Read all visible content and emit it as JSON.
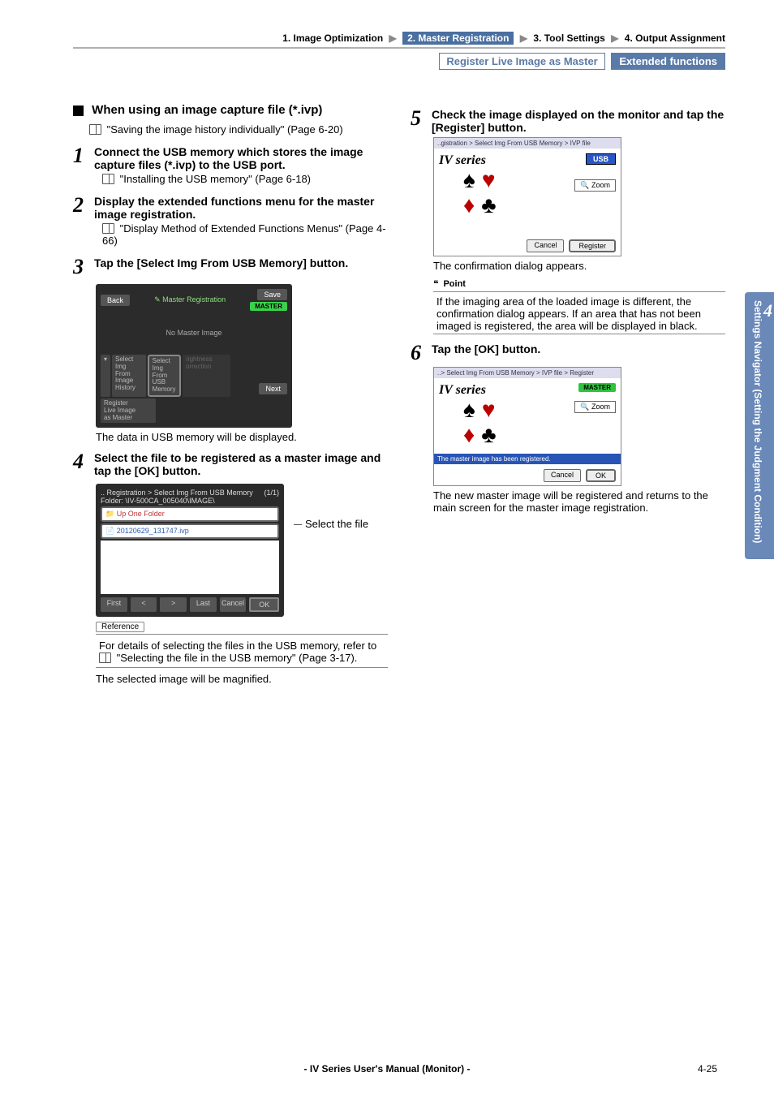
{
  "breadcrumb": {
    "item1": "1. Image Optimization",
    "item2": "2. Master Registration",
    "item3": "3. Tool Settings",
    "item4": "4. Output Assignment"
  },
  "subhead": {
    "left": "Register Live Image as Master",
    "right": "Extended functions"
  },
  "sidebar": {
    "num": "4",
    "label": "Settings Navigator (Setting the Judgment Condition)"
  },
  "left": {
    "section_title": "When using an image capture file (*.ivp)",
    "section_ref": "\"Saving the image history individually\" (Page 6-20)",
    "s1": {
      "title": "Connect the USB memory which stores the image capture files (*.ivp) to the USB port.",
      "ref": "\"Installing the USB memory\" (Page 6-18)"
    },
    "s2": {
      "title": "Display the extended functions menu for the master image registration.",
      "ref": "\"Display Method of Extended Functions Menus\" (Page 4-66)"
    },
    "s3": {
      "title": "Tap the [Select Img From USB Memory] button.",
      "scr": {
        "back": "Back",
        "hdr": "Master Registration",
        "save": "Save",
        "badge": "MASTER",
        "mid": "No Master Image",
        "b1": "Select Img\nFrom Image\nHistory",
        "b2": "Select Img\nFrom USB\nMemory",
        "b3": "rightness\norrection",
        "b4": "Register\nLive Image\nas Master",
        "next": "Next"
      },
      "after": "The data in USB memory will be displayed."
    },
    "s4": {
      "title": "Select the file to be registered as a master image and tap the [OK] button.",
      "scr": {
        "crumb": ".. Registration > Select Img From USB Memory",
        "page": "(1/1)",
        "folder_l": "Folder:",
        "folder_v": "\\IV-500CA_005040\\IMAGE\\",
        "up": "Up One Folder",
        "file": "20120629_131747.ivp",
        "first": "First",
        "prev": "<",
        "next": ">",
        "last": "Last",
        "cancel": "Cancel",
        "ok": "OK"
      },
      "callout": "Select the file",
      "ref_tag": "Reference",
      "ref_body": "For details of selecting the files in the USB memory, refer to   \"Selecting the file in the USB memory\" (Page 3-17).",
      "after": "The selected image will be magnified."
    }
  },
  "right": {
    "s5": {
      "title": "Check the image displayed on the monitor and tap the [Register] button.",
      "scr": {
        "crumb": "..gistration > Select Img From USB Memory > IVP file",
        "title": "IV series",
        "usb": "USB",
        "zoom": "Zoom",
        "cancel": "Cancel",
        "register": "Register"
      },
      "after": "The confirmation dialog appears.",
      "point_tag": "Point",
      "point_body": "If the imaging area of the loaded image is different, the confirmation dialog appears. If an area that has not been imaged is registered, the area will be displayed in black."
    },
    "s6": {
      "title": "Tap the [OK] button.",
      "scr": {
        "crumb": "..> Select Img From USB Memory > IVP file > Register",
        "title": "IV series",
        "master": "MASTER",
        "zoom": "Zoom",
        "msg": "The master image has been registered.",
        "cancel": "Cancel",
        "ok": "OK"
      },
      "after": "The new master image will be registered and returns to the main screen for the master image registration."
    }
  },
  "footer": {
    "center": "- IV Series User's Manual (Monitor) -",
    "page": "4-25"
  }
}
